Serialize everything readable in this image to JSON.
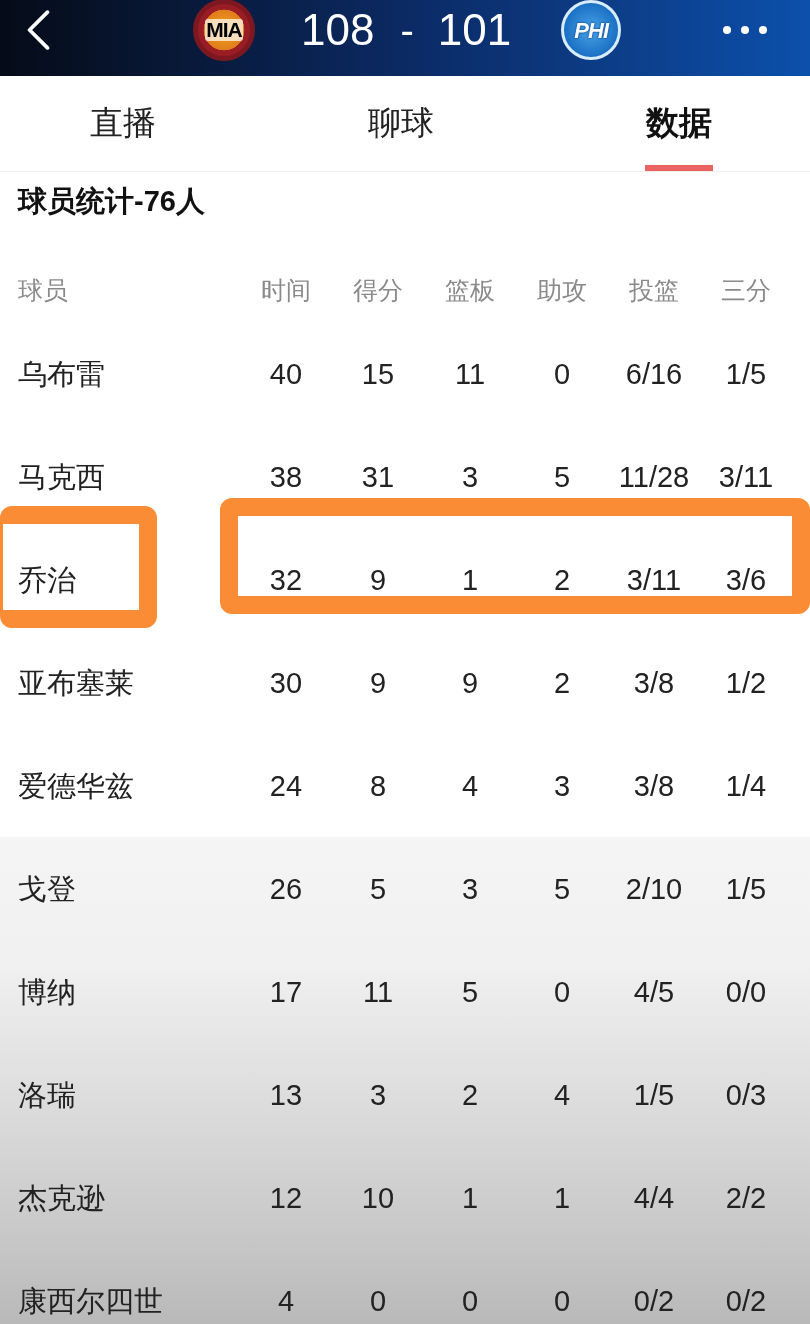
{
  "header": {
    "home_team": {
      "code": "MIA"
    },
    "score": {
      "home": "108",
      "separator": "-",
      "away": "101"
    },
    "away_team": {
      "code": "PHI"
    }
  },
  "tabs": [
    {
      "label": "直播",
      "selected": false
    },
    {
      "label": "聊球",
      "selected": false
    },
    {
      "label": "数据",
      "selected": true
    }
  ],
  "section_title": "球员统计-76人",
  "table": {
    "columns": [
      "球员",
      "时间",
      "得分",
      "篮板",
      "助攻",
      "投篮",
      "三分"
    ],
    "rows": [
      {
        "kind": "starter",
        "highlighted": false,
        "cells": [
          "乌布雷",
          "40",
          "15",
          "11",
          "0",
          "6/16",
          "1/5"
        ]
      },
      {
        "kind": "starter",
        "highlighted": false,
        "cells": [
          "马克西",
          "38",
          "31",
          "3",
          "5",
          "11/28",
          "3/11"
        ]
      },
      {
        "kind": "starter",
        "highlighted": true,
        "cells": [
          "乔治",
          "32",
          "9",
          "1",
          "2",
          "3/11",
          "3/6"
        ]
      },
      {
        "kind": "starter",
        "highlighted": false,
        "cells": [
          "亚布塞莱",
          "30",
          "9",
          "9",
          "2",
          "3/8",
          "1/2"
        ]
      },
      {
        "kind": "starter",
        "highlighted": false,
        "cells": [
          "爱德华兹",
          "24",
          "8",
          "4",
          "3",
          "3/8",
          "1/4"
        ]
      },
      {
        "kind": "bench",
        "highlighted": false,
        "cells": [
          "戈登",
          "26",
          "5",
          "3",
          "5",
          "2/10",
          "1/5"
        ]
      },
      {
        "kind": "bench",
        "highlighted": false,
        "cells": [
          "博纳",
          "17",
          "11",
          "5",
          "0",
          "4/5",
          "0/0"
        ]
      },
      {
        "kind": "bench",
        "highlighted": false,
        "cells": [
          "洛瑞",
          "13",
          "3",
          "2",
          "4",
          "1/5",
          "0/3"
        ]
      },
      {
        "kind": "bench",
        "highlighted": false,
        "cells": [
          "杰克逊",
          "12",
          "10",
          "1",
          "1",
          "4/4",
          "2/2"
        ]
      },
      {
        "kind": "bench",
        "highlighted": false,
        "cells": [
          "康西尔四世",
          "4",
          "0",
          "0",
          "0",
          "0/2",
          "0/2"
        ]
      }
    ]
  }
}
